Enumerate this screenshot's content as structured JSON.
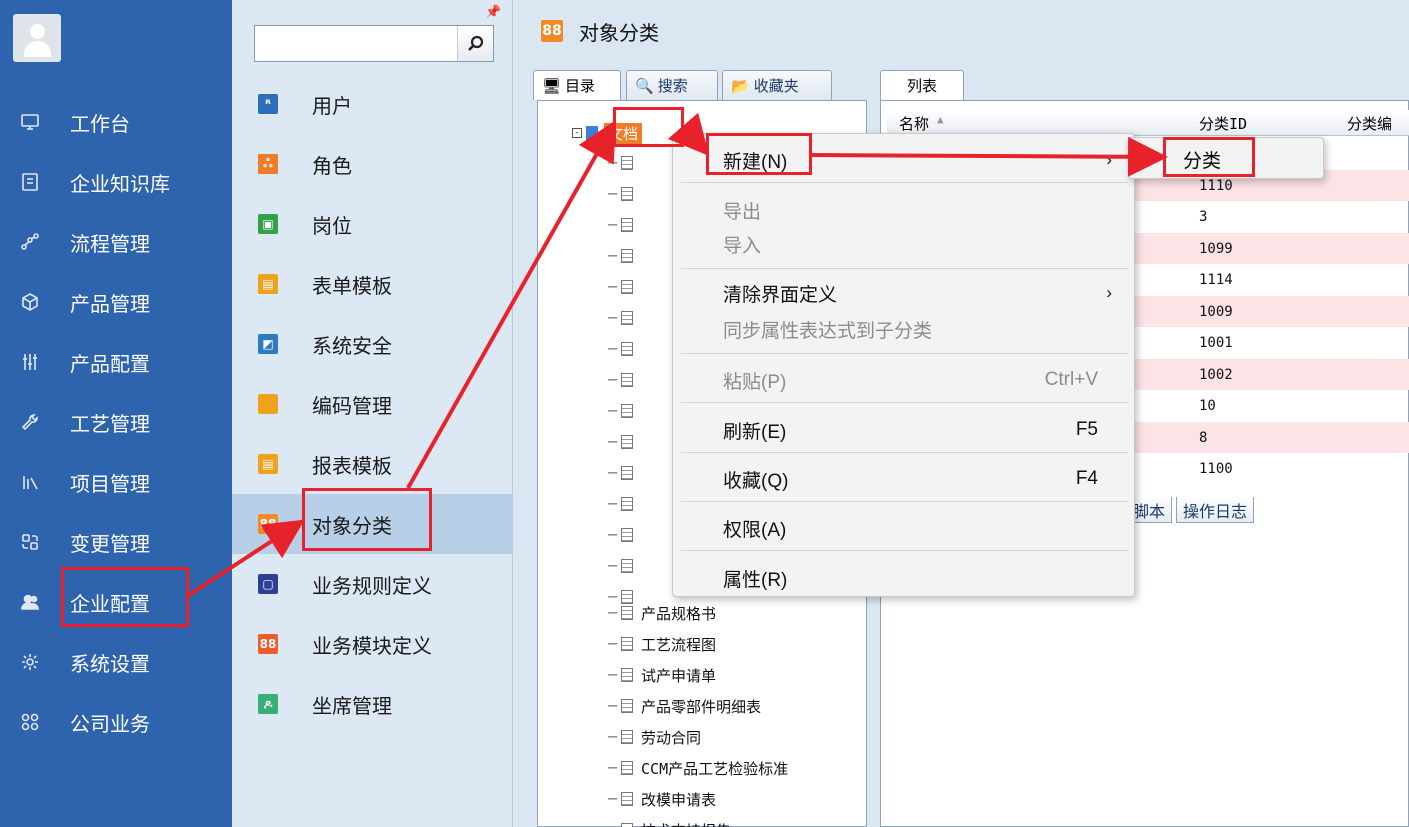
{
  "nav": {
    "items": [
      {
        "label": "工作台",
        "icon": "monitor-icon"
      },
      {
        "label": "企业知识库",
        "icon": "book-icon"
      },
      {
        "label": "流程管理",
        "icon": "flow-icon"
      },
      {
        "label": "产品管理",
        "icon": "cube-icon"
      },
      {
        "label": "产品配置",
        "icon": "sliders-icon"
      },
      {
        "label": "工艺管理",
        "icon": "wrench-icon"
      },
      {
        "label": "项目管理",
        "icon": "chart-icon"
      },
      {
        "label": "变更管理",
        "icon": "change-icon"
      },
      {
        "label": "企业配置",
        "icon": "users-icon"
      },
      {
        "label": "系统设置",
        "icon": "gear-icon"
      },
      {
        "label": "公司业务",
        "icon": "grid-icon"
      }
    ]
  },
  "col2": {
    "search_placeholder": "",
    "items": [
      {
        "label": "用户",
        "color": "#2e6db7",
        "icon": "user-icon"
      },
      {
        "label": "角色",
        "color": "#f07b28",
        "icon": "role-icon"
      },
      {
        "label": "岗位",
        "color": "#35a04a",
        "icon": "post-icon"
      },
      {
        "label": "表单模板",
        "color": "#f0a21e",
        "icon": "form-icon"
      },
      {
        "label": "系统安全",
        "color": "#2f7bc2",
        "icon": "security-icon"
      },
      {
        "label": "编码管理",
        "color": "#f0a21e",
        "icon": "code-icon"
      },
      {
        "label": "报表模板",
        "color": "#f0a21e",
        "icon": "report-icon"
      },
      {
        "label": "对象分类",
        "color": "#f28a23",
        "icon": "category-icon"
      },
      {
        "label": "业务规则定义",
        "color": "#2b3f95",
        "icon": "rule-icon"
      },
      {
        "label": "业务模块定义",
        "color": "#ef5a28",
        "icon": "module-icon"
      },
      {
        "label": "坐席管理",
        "color": "#3aae7a",
        "icon": "seat-icon"
      }
    ]
  },
  "main": {
    "title": "对象分类",
    "tree_tabs": [
      "目录",
      "搜索",
      "收藏夹"
    ],
    "list_tab": "列表",
    "columns": [
      "名称",
      "分类ID",
      "分类编"
    ],
    "ids": [
      "1110",
      "3",
      "1099",
      "1114",
      "1009",
      "1001",
      "1002",
      "10",
      "8",
      "1100"
    ],
    "bottom_tabs": [
      "脚本",
      "操作日志"
    ],
    "tree_root": "文档",
    "tree_items": [
      "产品规格书",
      "工艺流程图",
      "试产申请单",
      "产品零部件明细表",
      "劳动合同",
      "CCM产品工艺检验标准",
      "改模申请表",
      "技术支持报告"
    ]
  },
  "context_menu": {
    "new": "新建(N)",
    "export": "导出",
    "import": "导入",
    "clear_ui": "清除界面定义",
    "sync_attr": "同步属性表达式到子分类",
    "paste": "粘贴(P)",
    "paste_shortcut": "Ctrl+V",
    "refresh": "刷新(E)",
    "refresh_shortcut": "F5",
    "favorite": "收藏(Q)",
    "favorite_shortcut": "F4",
    "permission": "权限(A)",
    "properties": "属性(R)"
  },
  "submenu": {
    "category": "分类"
  },
  "colors": {
    "nav_bg": "#2e63ad",
    "annotation_red": "#e8222a"
  }
}
